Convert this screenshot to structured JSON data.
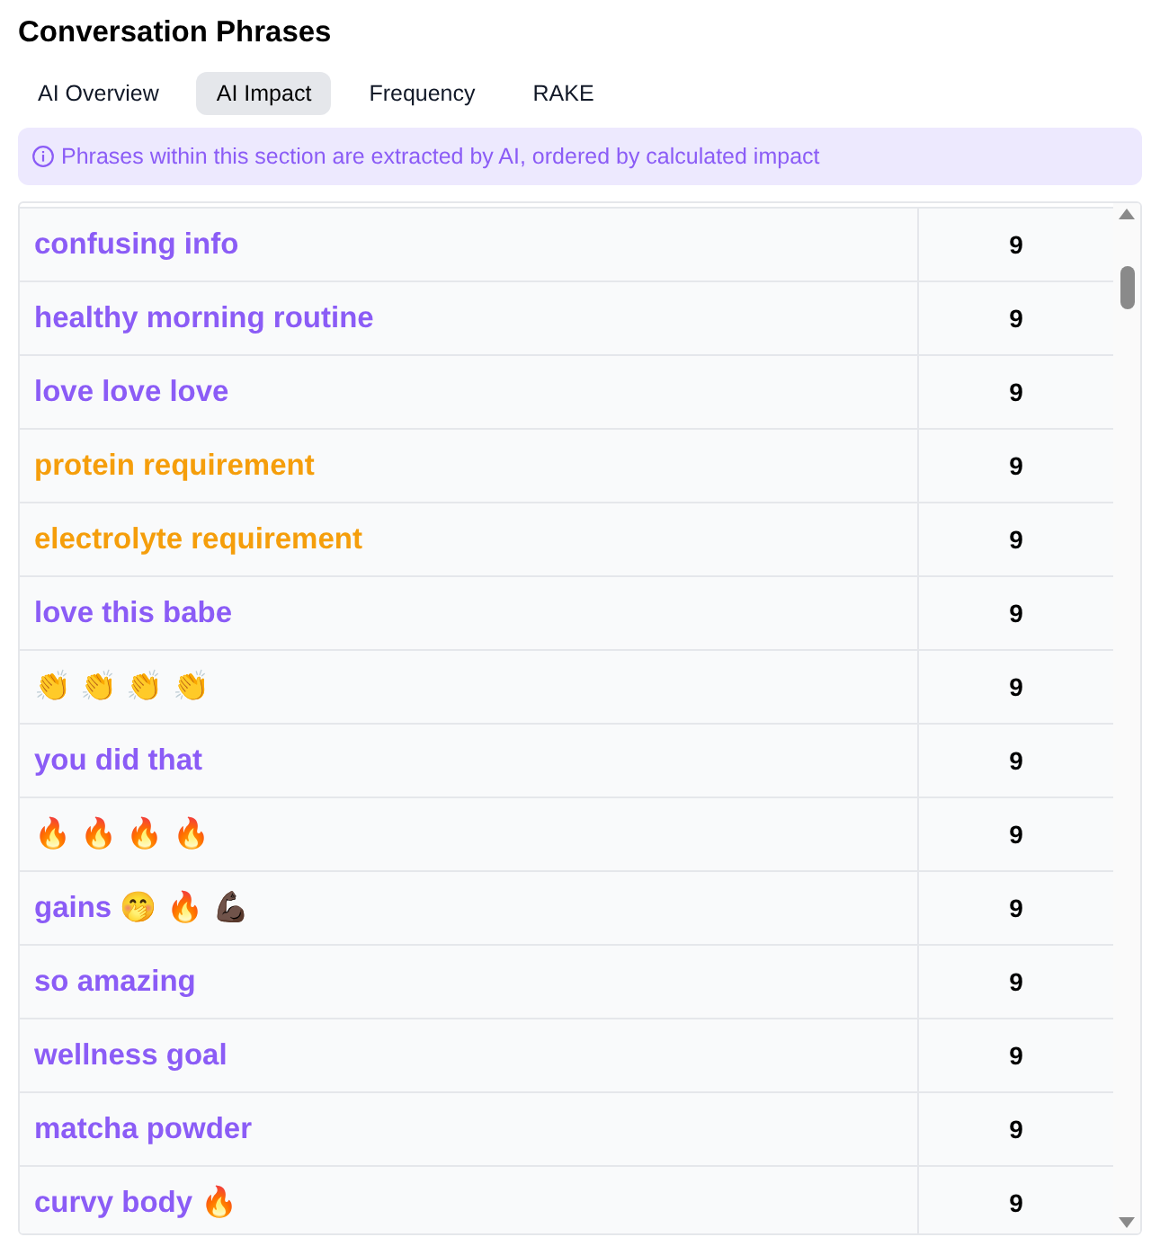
{
  "title": "Conversation Phrases",
  "tabs": [
    {
      "label": "AI Overview",
      "selected": false
    },
    {
      "label": "AI Impact",
      "selected": true
    },
    {
      "label": "Frequency",
      "selected": false
    },
    {
      "label": "RAKE",
      "selected": false
    }
  ],
  "info_banner": {
    "text": "Phrases within this section are extracted by AI, ordered by calculated impact"
  },
  "table": {
    "rows": [
      {
        "phrase": "confusing info",
        "score": "9",
        "color": "#8b5cf6"
      },
      {
        "phrase": "healthy morning routine",
        "score": "9",
        "color": "#8b5cf6"
      },
      {
        "phrase": "love love love",
        "score": "9",
        "color": "#8b5cf6"
      },
      {
        "phrase": "protein requirement",
        "score": "9",
        "color": "#f59e0b"
      },
      {
        "phrase": "electrolyte requirement",
        "score": "9",
        "color": "#f59e0b"
      },
      {
        "phrase": "love this babe",
        "score": "9",
        "color": "#8b5cf6"
      },
      {
        "phrase": "👏 👏 👏 👏",
        "score": "9"
      },
      {
        "phrase": "you did that",
        "score": "9",
        "color": "#8b5cf6"
      },
      {
        "phrase": "🔥 🔥 🔥 🔥",
        "score": "9"
      },
      {
        "phrase": "gains 🤭 🔥 💪🏿",
        "score": "9",
        "color": "#8b5cf6"
      },
      {
        "phrase": "so amazing",
        "score": "9",
        "color": "#8b5cf6"
      },
      {
        "phrase": "wellness goal",
        "score": "9",
        "color": "#8b5cf6"
      },
      {
        "phrase": "matcha powder",
        "score": "9",
        "color": "#8b5cf6"
      },
      {
        "phrase": "curvy body 🔥",
        "score": "9",
        "color": "#8b5cf6"
      }
    ]
  }
}
